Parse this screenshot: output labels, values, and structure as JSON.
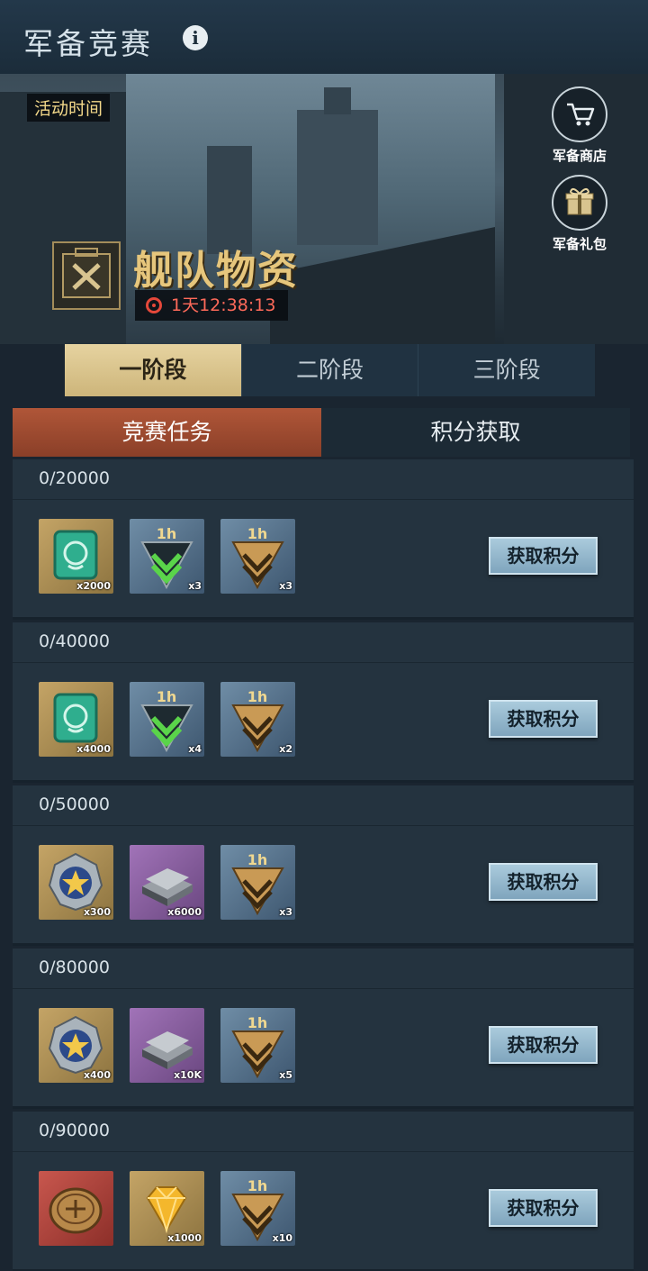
{
  "header": {
    "title": "军备竞赛",
    "info_icon": "info-icon",
    "info_glyph": "i"
  },
  "banner": {
    "activity_time_label": "活动时间",
    "event_title": "舰队物资",
    "countdown": "1天12:38:13",
    "shop_label": "军备商店",
    "gift_label": "军备礼包"
  },
  "stage_tabs": [
    "一阶段",
    "二阶段",
    "三阶段"
  ],
  "section_tabs": [
    "竞赛任务",
    "积分获取"
  ],
  "button_label": "获取积分",
  "tasks": [
    {
      "score": "0/20000",
      "rewards": [
        {
          "type": "green-token",
          "color": "gold",
          "qty": "x2000"
        },
        {
          "type": "green-speedup-1h",
          "color": "blue",
          "qty": "x3"
        },
        {
          "type": "gold-speedup-1h",
          "color": "blue",
          "qty": "x3"
        }
      ]
    },
    {
      "score": "0/40000",
      "rewards": [
        {
          "type": "green-token",
          "color": "gold",
          "qty": "x4000"
        },
        {
          "type": "green-speedup-1h",
          "color": "blue",
          "qty": "x4"
        },
        {
          "type": "gold-speedup-1h",
          "color": "blue",
          "qty": "x2"
        }
      ]
    },
    {
      "score": "0/50000",
      "rewards": [
        {
          "type": "star-medal",
          "color": "gold",
          "qty": "x300"
        },
        {
          "type": "steel-ingot",
          "color": "purple",
          "qty": "x6000"
        },
        {
          "type": "gold-speedup-1h",
          "color": "blue",
          "qty": "x3"
        }
      ]
    },
    {
      "score": "0/80000",
      "rewards": [
        {
          "type": "star-medal",
          "color": "gold",
          "qty": "x400"
        },
        {
          "type": "steel-ingot",
          "color": "purple",
          "qty": "x10K"
        },
        {
          "type": "gold-speedup-1h",
          "color": "blue",
          "qty": "x5"
        }
      ]
    },
    {
      "score": "0/90000",
      "rewards": [
        {
          "type": "coin",
          "color": "red",
          "qty": ""
        },
        {
          "type": "gold-diamond",
          "color": "gold",
          "qty": "x1000"
        },
        {
          "type": "gold-speedup-1h",
          "color": "blue",
          "qty": "x10"
        }
      ]
    }
  ],
  "colors": {
    "accent_gold": "#cdb57a",
    "accent_red": "#b05638",
    "button_blue": "#8fb4ca",
    "timer_red": "#ff6a5a"
  }
}
